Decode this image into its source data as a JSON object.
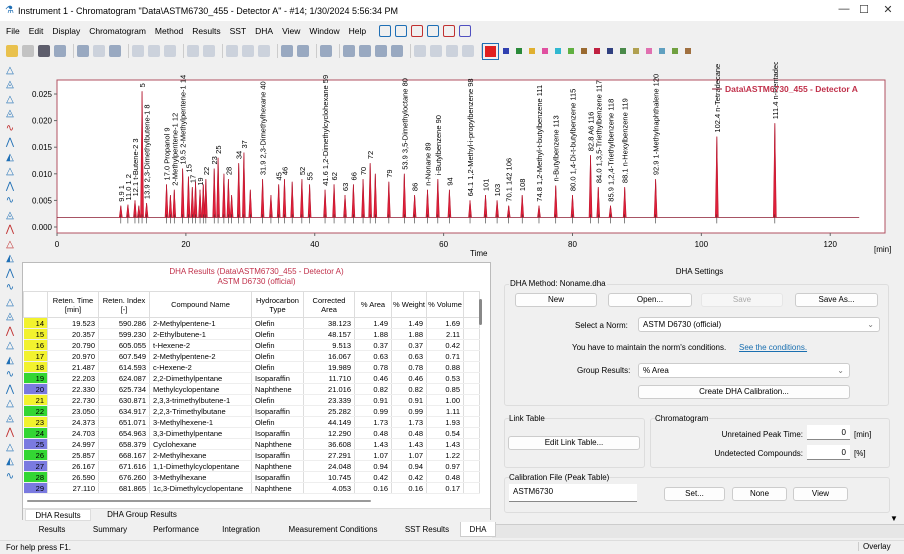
{
  "window": {
    "title": "Instrument 1 - Chromatogram \"Data\\ASTM6730_455 - Detector A\" - #14;   1/30/2024   5:56:34 PM",
    "minimize": "—",
    "maximize": "☐",
    "close": "✕"
  },
  "menu": [
    "File",
    "Edit",
    "Display",
    "Chromatogram",
    "Method",
    "Results",
    "SST",
    "DHA",
    "View",
    "Window",
    "Help"
  ],
  "toolbar": {
    "icons": [
      "open-folder-icon",
      "save-icon",
      "close-icon",
      "export-icon",
      "sep",
      "report-icon",
      "preview-icon",
      "print-icon",
      "sep",
      "cut-icon",
      "copy-icon",
      "paste-icon",
      "sep",
      "undo-icon",
      "redo-icon",
      "sep",
      "zoom-in-icon",
      "zoom-out-icon",
      "zoom-reset-icon",
      "sep",
      "wrench-icon",
      "help-icon",
      "sep",
      "chromatogram-icon",
      "sep",
      "move-icon",
      "fit-icon",
      "integration-icon",
      "calculator-icon",
      "sep",
      "first-icon",
      "prev-icon",
      "next-icon",
      "last-icon"
    ],
    "color_squares": [
      "#e02020",
      "#3040b0",
      "#2a8a3a",
      "#e0b030",
      "#e050a0",
      "#30b8d0",
      "#60b040",
      "#9a6a30",
      "#c02040",
      "#304080",
      "#4a8a4a",
      "#b0a050",
      "#e070b0",
      "#60a0c0",
      "#70a040",
      "#a07040"
    ]
  },
  "chart_data": {
    "type": "line",
    "legend": "Data\\ASTM6730_455 - Detector A",
    "legend_position": "top-right",
    "xlabel": "Time",
    "xunit": "[min]",
    "xlim": [
      0,
      128.5
    ],
    "ylim": [
      0,
      0.0276
    ],
    "xticks": [
      0,
      20,
      40,
      60,
      80,
      100,
      120
    ],
    "yticks": [
      "0.000",
      "0.005",
      "0.010",
      "0.015",
      "0.020",
      "0.025"
    ],
    "baseline": 0.0018,
    "peaks": [
      {
        "t": 9.9,
        "h": 0.004,
        "label": "9.9  1"
      },
      {
        "t": 11.0,
        "h": 0.0042,
        "label": "11.0 1  2"
      },
      {
        "t": 12.1,
        "h": 0.005,
        "label": "12.1 t-Butene-2  3"
      },
      {
        "t": 12.7,
        "h": 0.004,
        "label": ""
      },
      {
        "t": 13.2,
        "h": 0.0255,
        "label": "5"
      },
      {
        "t": 13.9,
        "h": 0.0045,
        "label": "13.9 2,3-Dimethylbutene-1  8"
      },
      {
        "t": 17.0,
        "h": 0.008,
        "label": "17.0 Propanol  9"
      },
      {
        "t": 17.6,
        "h": 0.006,
        "label": ""
      },
      {
        "t": 18.2,
        "h": 0.007,
        "label": "2-Methylpentene-1  12"
      },
      {
        "t": 19.5,
        "h": 0.011,
        "label": "19.5 2-Methylpentene-1  14"
      },
      {
        "t": 20.4,
        "h": 0.0095,
        "label": "15"
      },
      {
        "t": 21.0,
        "h": 0.0075,
        "label": "17"
      },
      {
        "t": 21.5,
        "h": 0.0085,
        "label": ""
      },
      {
        "t": 22.2,
        "h": 0.007,
        "label": "19"
      },
      {
        "t": 22.7,
        "h": 0.008,
        "label": ""
      },
      {
        "t": 23.1,
        "h": 0.009,
        "label": "22"
      },
      {
        "t": 24.4,
        "h": 0.011,
        "label": "23"
      },
      {
        "t": 25.0,
        "h": 0.013,
        "label": "25"
      },
      {
        "t": 25.9,
        "h": 0.01,
        "label": ""
      },
      {
        "t": 26.6,
        "h": 0.009,
        "label": "28"
      },
      {
        "t": 27.1,
        "h": 0.006,
        "label": ""
      },
      {
        "t": 28.2,
        "h": 0.012,
        "label": "34"
      },
      {
        "t": 29.0,
        "h": 0.014,
        "label": "37"
      },
      {
        "t": 30.0,
        "h": 0.007,
        "label": ""
      },
      {
        "t": 31.9,
        "h": 0.009,
        "label": "31.9 2,3-Dimethylhexane  40"
      },
      {
        "t": 33.2,
        "h": 0.006,
        "label": ""
      },
      {
        "t": 34.4,
        "h": 0.008,
        "label": "45"
      },
      {
        "t": 35.3,
        "h": 0.009,
        "label": "46"
      },
      {
        "t": 36.5,
        "h": 0.0085,
        "label": ""
      },
      {
        "t": 38.0,
        "h": 0.009,
        "label": "52"
      },
      {
        "t": 39.2,
        "h": 0.008,
        "label": "55"
      },
      {
        "t": 41.6,
        "h": 0.007,
        "label": "41.6 1,2-Dimethylcyclohexane  59"
      },
      {
        "t": 43.0,
        "h": 0.008,
        "label": "62"
      },
      {
        "t": 44.7,
        "h": 0.006,
        "label": "63"
      },
      {
        "t": 46.0,
        "h": 0.008,
        "label": "66"
      },
      {
        "t": 47.5,
        "h": 0.009,
        "label": "70"
      },
      {
        "t": 48.6,
        "h": 0.012,
        "label": "72"
      },
      {
        "t": 49.4,
        "h": 0.01,
        "label": ""
      },
      {
        "t": 51.5,
        "h": 0.0085,
        "label": "79"
      },
      {
        "t": 53.9,
        "h": 0.01,
        "label": "53.9 3,5-Dimethyloctane  80"
      },
      {
        "t": 55.5,
        "h": 0.006,
        "label": "86"
      },
      {
        "t": 57.5,
        "h": 0.007,
        "label": "n-Nonane  89"
      },
      {
        "t": 59.1,
        "h": 0.009,
        "label": "i-Butylbenzene  90"
      },
      {
        "t": 60.9,
        "h": 0.007,
        "label": "94"
      },
      {
        "t": 64.1,
        "h": 0.005,
        "label": "64.1 1,2-Methyl-i-propylbenzene  98"
      },
      {
        "t": 66.5,
        "h": 0.006,
        "label": "101"
      },
      {
        "t": 68.3,
        "h": 0.005,
        "label": "103"
      },
      {
        "t": 70.1,
        "h": 0.004,
        "label": "70.1 142  106"
      },
      {
        "t": 72.2,
        "h": 0.006,
        "label": "108"
      },
      {
        "t": 74.8,
        "h": 0.004,
        "label": "74.8 1,2-Methyl-t-butylbenzene  111"
      },
      {
        "t": 77.4,
        "h": 0.0078,
        "label": "n-Butylbenzene  113"
      },
      {
        "t": 80.0,
        "h": 0.006,
        "label": "80.0 1,4-Di-t-butylbenzene  115"
      },
      {
        "t": 82.8,
        "h": 0.0135,
        "label": "82.8 A6  116"
      },
      {
        "t": 84.0,
        "h": 0.0075,
        "label": "84.0 1,3,5-Triethylbenzene  117"
      },
      {
        "t": 85.9,
        "h": 0.004,
        "label": "85.9 1,2,4-Triethylbenzene  118"
      },
      {
        "t": 88.1,
        "h": 0.0075,
        "label": "88.1 n-Hexylbenzene  119"
      },
      {
        "t": 92.9,
        "h": 0.009,
        "label": "92.9 1-Methylnaphthalene  120"
      },
      {
        "t": 102.4,
        "h": 0.017,
        "label": "102.4 n-Tetradecane  121"
      },
      {
        "t": 111.4,
        "h": 0.0195,
        "label": "111.4 n-Pentadecane  122"
      }
    ]
  },
  "results": {
    "title": "DHA Results (Data\\ASTM6730_455 - Detector A)",
    "subtitle": "ASTM D6730 (official)",
    "columns": [
      "",
      "Reten. Time [min]",
      "Reten. Index [-]",
      "Compound Name",
      "Hydrocarbon Type",
      "Corrected Area",
      "% Area",
      "% Weight",
      "% Volume"
    ],
    "type_colors": {
      "Olefin": "#f2f22e",
      "Isoparaffin": "#33d633",
      "Naphthene": "#7a7ae0"
    },
    "rows": [
      [
        "14",
        "19.523",
        "590.286",
        "2-Methylpentene-1",
        "Olefin",
        "38.123",
        "1.49",
        "1.49",
        "1.69"
      ],
      [
        "15",
        "20.357",
        "599.230",
        "2-Ethylbutene-1",
        "Olefin",
        "48.157",
        "1.88",
        "1.88",
        "2.11"
      ],
      [
        "16",
        "20.790",
        "605.055",
        "t-Hexene-2",
        "Olefin",
        "9.513",
        "0.37",
        "0.37",
        "0.42"
      ],
      [
        "17",
        "20.970",
        "607.549",
        "2-Methylpentene-2",
        "Olefin",
        "16.067",
        "0.63",
        "0.63",
        "0.71"
      ],
      [
        "18",
        "21.487",
        "614.593",
        "c-Hexene-2",
        "Olefin",
        "19.989",
        "0.78",
        "0.78",
        "0.88"
      ],
      [
        "19",
        "22.203",
        "624.087",
        "2,2-Dimethylpentane",
        "Isoparaffin",
        "11.710",
        "0.46",
        "0.46",
        "0.53"
      ],
      [
        "20",
        "22.330",
        "625.734",
        "Methylcyclopentane",
        "Naphthene",
        "21.016",
        "0.82",
        "0.82",
        "0.85"
      ],
      [
        "21",
        "22.730",
        "630.871",
        "2,3,3-trimethylbutene-1",
        "Olefin",
        "23.339",
        "0.91",
        "0.91",
        "1.00"
      ],
      [
        "22",
        "23.050",
        "634.917",
        "2,2,3-Trimethylbutane",
        "Isoparaffin",
        "25.282",
        "0.99",
        "0.99",
        "1.11"
      ],
      [
        "23",
        "24.373",
        "651.071",
        "3-Methylhexene-1",
        "Olefin",
        "44.149",
        "1.73",
        "1.73",
        "1.93"
      ],
      [
        "24",
        "24.703",
        "654.963",
        "3,3-Dimethylpentane",
        "Isoparaffin",
        "12.290",
        "0.48",
        "0.48",
        "0.54"
      ],
      [
        "25",
        "24.997",
        "658.379",
        "Cyclohexane",
        "Naphthene",
        "36.608",
        "1.43",
        "1.43",
        "1.43"
      ],
      [
        "26",
        "25.857",
        "668.167",
        "2-Methylhexane",
        "Isoparaffin",
        "27.291",
        "1.07",
        "1.07",
        "1.22"
      ],
      [
        "27",
        "26.167",
        "671.616",
        "1,1-Dimethylcyclopentane",
        "Naphthene",
        "24.048",
        "0.94",
        "0.94",
        "0.97"
      ],
      [
        "28",
        "26.590",
        "676.260",
        "3-Methylhexane",
        "Isoparaffin",
        "10.745",
        "0.42",
        "0.42",
        "0.48"
      ],
      [
        "29",
        "27.110",
        "681.865",
        "1c,3-Dimethylcyclopentane",
        "Naphthene",
        "4.053",
        "0.16",
        "0.16",
        "0.17"
      ]
    ],
    "subtabs": [
      "DHA Results",
      "DHA Group Results"
    ]
  },
  "settings": {
    "title": "DHA Settings",
    "method_label": "DHA Method: Noname.dha",
    "new": "New",
    "open": "Open...",
    "save": "Save",
    "save_as": "Save As...",
    "norm_label": "Select a Norm:",
    "norm_value": "ASTM D6730 (official)",
    "norm_note": "You have to maintain the norm's conditions.",
    "norm_link": "See the conditions.",
    "group_label": "Group Results:",
    "group_value": "% Area",
    "create_cal": "Create DHA Calibration...",
    "link_table_label": "Link Table",
    "edit_link": "Edit Link Table...",
    "chrom_label": "Chromatogram",
    "unretained_label": "Unretained Peak Time:",
    "unretained_value": "0",
    "unretained_unit": "[min]",
    "undetected_label": "Undetected Compounds:",
    "undetected_value": "0",
    "undetected_unit": "[%]",
    "cal_label": "Calibration File (Peak Table)",
    "cal_value": "ASTM6730",
    "set": "Set...",
    "none": "None",
    "view": "View"
  },
  "bottom_tabs": [
    "Results",
    "Summary",
    "Performance",
    "Integration",
    "Measurement Conditions",
    "SST Results",
    "DHA"
  ],
  "active_tab": "DHA",
  "status": {
    "help": "For help press F1.",
    "mode": "Overlay"
  }
}
